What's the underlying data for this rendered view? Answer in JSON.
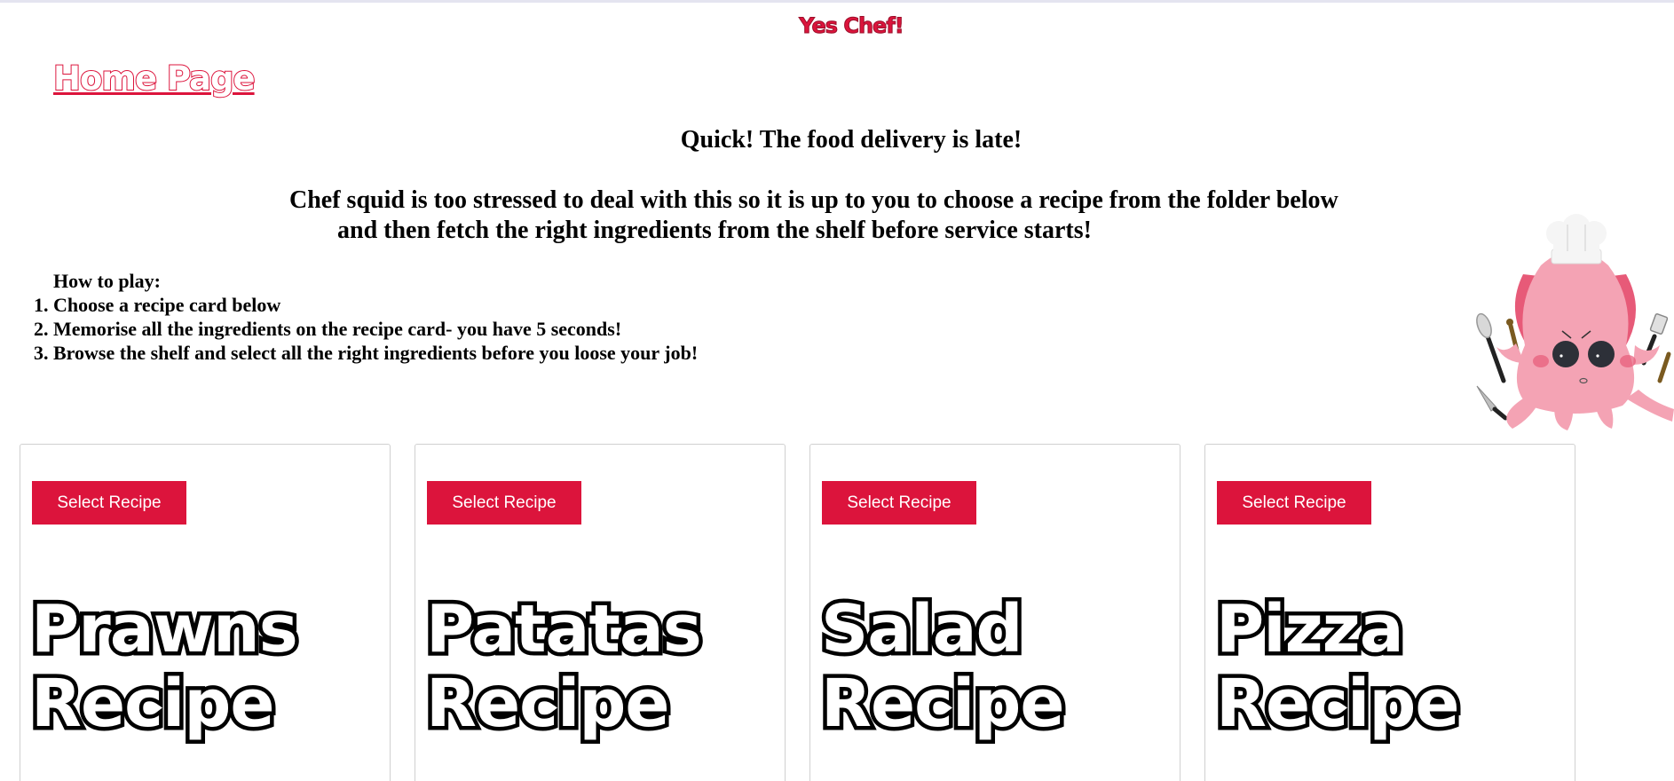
{
  "header": {
    "site_title": "Yes Chef!",
    "home_link": "Home Page"
  },
  "main": {
    "headline": "Quick! The food delivery is late!",
    "intro_line1": "Chef squid is too stressed to deal with this so it is up to you to choose a recipe from the folder below",
    "intro_line2": "and then fetch the right ingredients from the shelf before service starts!",
    "howto_heading": "How to play:",
    "steps": [
      "Choose a recipe card below",
      "Memorise all the ingredients on the recipe card- you have 5 seconds!",
      "Browse the shelf and select all the right ingredients before you loose your job!"
    ]
  },
  "cards": [
    {
      "button_label": "Select Recipe",
      "title_word": "Prawns",
      "title_suffix": "Recipe"
    },
    {
      "button_label": "Select Recipe",
      "title_word": "Patatas",
      "title_suffix": "Recipe"
    },
    {
      "button_label": "Select Recipe",
      "title_word": "Salad",
      "title_suffix": "Recipe"
    },
    {
      "button_label": "Select Recipe",
      "title_word": "Pizza",
      "title_suffix": "Recipe"
    }
  ],
  "colors": {
    "accent": "#dc143c",
    "text": "#000000",
    "card_border": "#d0d0d0",
    "squid_body": "#f4a3b4",
    "squid_dark": "#e75a78"
  },
  "icons": {
    "mascot": "chef-squid-illustration"
  }
}
